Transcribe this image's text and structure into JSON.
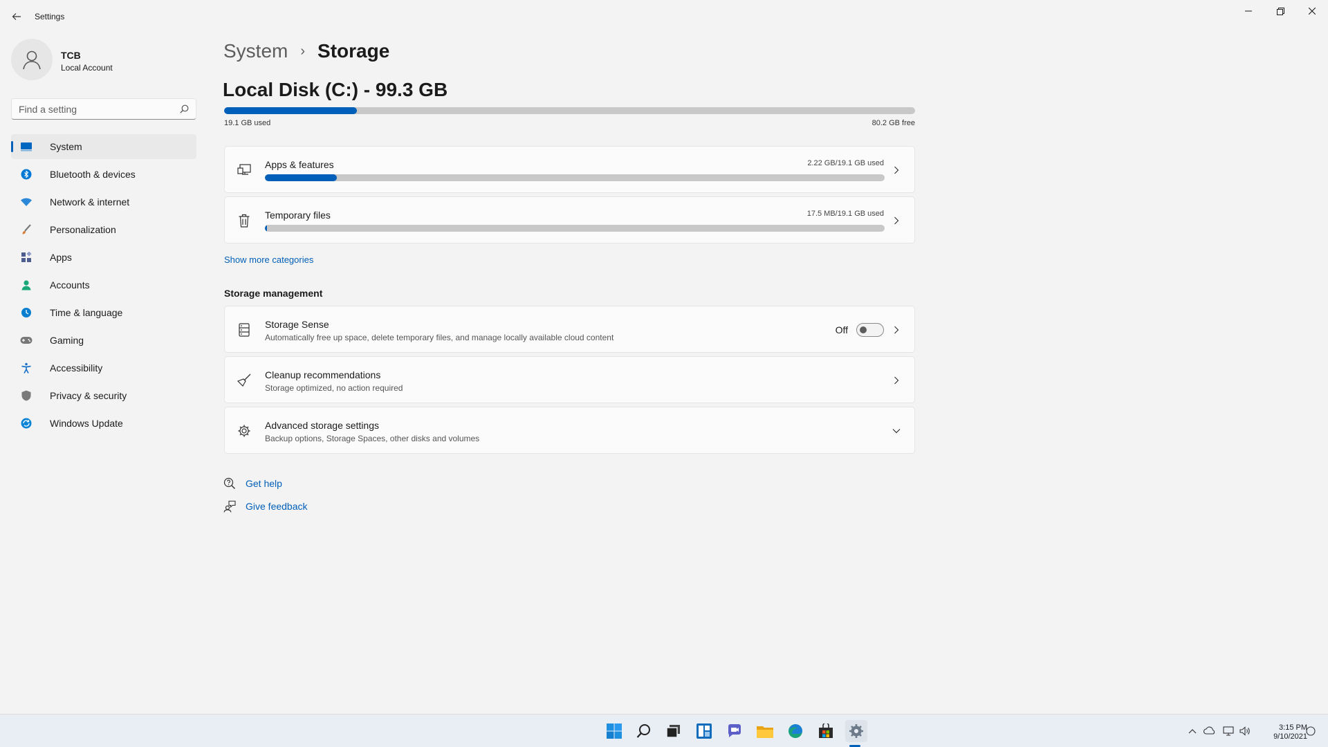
{
  "window": {
    "title": "Settings"
  },
  "user": {
    "name": "TCB",
    "account_type": "Local Account"
  },
  "search": {
    "placeholder": "Find a setting"
  },
  "sidebar": {
    "items": [
      {
        "label": "System",
        "icon": "system-icon",
        "color": "#0067c0"
      },
      {
        "label": "Bluetooth & devices",
        "icon": "bluetooth-icon",
        "color": "#0078d4"
      },
      {
        "label": "Network & internet",
        "icon": "wifi-icon",
        "color": "#2b88d8"
      },
      {
        "label": "Personalization",
        "icon": "brush-icon",
        "color": "#d97b36"
      },
      {
        "label": "Apps",
        "icon": "apps-icon",
        "color": "#4e5d8f"
      },
      {
        "label": "Accounts",
        "icon": "person-icon",
        "color": "#1aa87a"
      },
      {
        "label": "Time & language",
        "icon": "globe-clock-icon",
        "color": "#0a7ecf"
      },
      {
        "label": "Gaming",
        "icon": "gamepad-icon",
        "color": "#777777"
      },
      {
        "label": "Accessibility",
        "icon": "accessibility-icon",
        "color": "#1c73c9"
      },
      {
        "label": "Privacy & security",
        "icon": "shield-icon",
        "color": "#7a7a7a"
      },
      {
        "label": "Windows Update",
        "icon": "update-icon",
        "color": "#0a84d6"
      }
    ],
    "active_index": 0
  },
  "breadcrumb": {
    "parent": "System",
    "separator": "›",
    "current": "Storage"
  },
  "disk": {
    "title": "Local Disk (C:) - 99.3 GB",
    "used_label": "19.1 GB used",
    "free_label": "80.2 GB free",
    "used_fraction": 0.192
  },
  "categories": [
    {
      "title": "Apps & features",
      "usage": "2.22 GB/19.1 GB used",
      "fraction": 0.116,
      "icon": "apps-features-icon"
    },
    {
      "title": "Temporary files",
      "usage": "17.5 MB/19.1 GB used",
      "fraction": 0.002,
      "icon": "trash-icon"
    }
  ],
  "show_more": "Show more categories",
  "storage_management": {
    "heading": "Storage management",
    "storage_sense": {
      "title": "Storage Sense",
      "subtitle": "Automatically free up space, delete temporary files, and manage locally available cloud content",
      "toggle_label": "Off",
      "toggle_on": false
    },
    "cleanup": {
      "title": "Cleanup recommendations",
      "subtitle": "Storage optimized, no action required"
    },
    "advanced": {
      "title": "Advanced storage settings",
      "subtitle": "Backup options, Storage Spaces, other disks and volumes"
    }
  },
  "help": {
    "get_help": "Get help",
    "give_feedback": "Give feedback"
  },
  "taskbar": {
    "icons": [
      "start-icon",
      "search-icon",
      "task-view-icon",
      "widgets-icon",
      "chat-icon",
      "file-explorer-icon",
      "edge-icon",
      "store-icon",
      "settings-icon"
    ],
    "active": "settings-icon",
    "clock_time": "3:15 PM",
    "clock_date": "9/10/2021"
  },
  "colors": {
    "accent": "#005fb8",
    "background": "#f3f3f3",
    "card": "#fbfbfb",
    "bar_track": "#c8c8c8"
  }
}
